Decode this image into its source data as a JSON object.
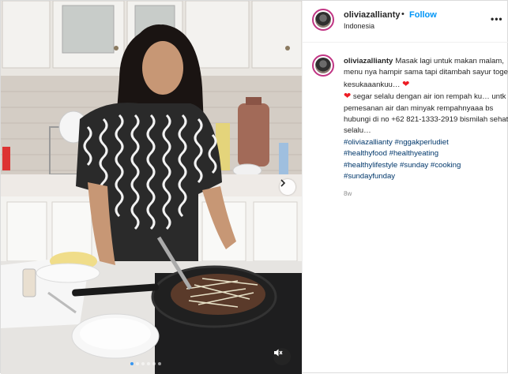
{
  "post": {
    "username": "oliviazallianty",
    "follow_label": "Follow",
    "separator": "•",
    "location": "Indonesia",
    "more_icon": "•••",
    "caption": {
      "line1": "Masak lagi untuk makan malam, menu nya hampir sama tapi ditambah sayur toge kesukaaankuu…",
      "heart": "❤",
      "line2": "segar selalu dengan air ion rempah ku… untk pemesanan air dan minyak rempahnyaaa bs hubungi di no +62 821-1333-2919 bismilah sehat selalu…",
      "hashtags": [
        "#oliviazallianty",
        "#nggakperludiet",
        "#healthyfood",
        "#healthyeating",
        "#healthylifestyle",
        "#sunday",
        "#cooking",
        "#sundayfunday"
      ]
    },
    "age": "8w"
  },
  "media": {
    "next_icon": "chevron-right-icon",
    "mute_icon": "speaker-muted-icon",
    "carousel_count": 6,
    "active_index": 0
  },
  "colors": {
    "link": "#0095f6",
    "hashtag": "#00376b",
    "story_ring": "#c13584",
    "heart": "#ed1c24"
  }
}
